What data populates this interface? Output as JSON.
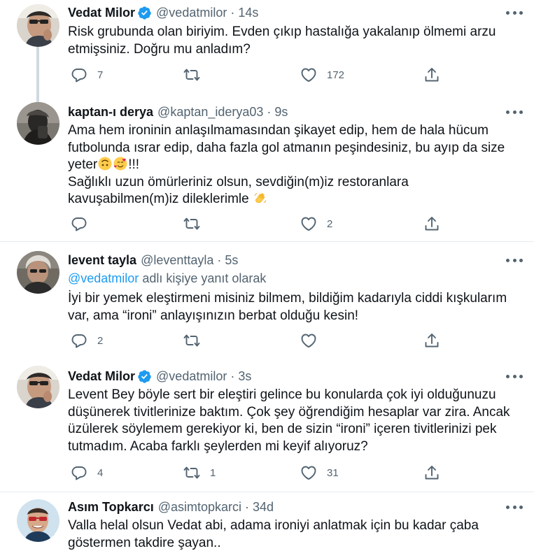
{
  "tweets": [
    {
      "name": "Vedat Milor",
      "verified": true,
      "handle": "@vedatmilor",
      "dot": "·",
      "time": "14s",
      "lines": [
        "Risk grubunda olan biriyim. Evden çıkıp hastalığa yakalanıp ölmemi arzu",
        "etmişsiniz. Doğru mu anladım?"
      ],
      "reply_count": "7",
      "retweet_count": "",
      "like_count": "172"
    },
    {
      "name": "kaptan-ı derya",
      "verified": false,
      "handle": "@kaptan_iderya03",
      "dot": "·",
      "time": "9s",
      "lines": [
        "Ama hem ironinin anlaşılmamasından şikayet edip, hem de hala hücum",
        "futbolunda ısrar edip, daha fazla gol atmanın peşindesiniz, bu ayıp da size",
        "yeter",
        "!!!",
        "Sağlıklı uzun ömürleriniz olsun, sevdiğin(m)iz  restoranlara",
        "kavuşabilmen(m)iz dileklerimle"
      ],
      "emojis": [
        "upside-down-face-emoji",
        "smiling-face-with-hearts-emoji",
        "waving-hand-emoji"
      ],
      "reply_count": "",
      "retweet_count": "",
      "like_count": "2"
    },
    {
      "name": "levent tayla",
      "verified": false,
      "handle": "@leventtayla",
      "dot": "·",
      "time": "5s",
      "reply_to_mention": "@vedatmilor",
      "reply_to_text": " adlı kişiye yanıt olarak",
      "lines": [
        "İyi bir yemek eleştirmeni misiniz bilmem, bildiğim kadarıyla ciddi kışkularım",
        "var, ama “ironi” anlayışınızın berbat olduğu kesin!"
      ],
      "reply_count": "2",
      "retweet_count": "",
      "like_count": ""
    },
    {
      "name": "Vedat Milor",
      "verified": true,
      "handle": "@vedatmilor",
      "dot": "·",
      "time": "3s",
      "lines": [
        "Levent Bey böyle sert bir eleştiri gelince bu konularda çok iyi olduğunuzu",
        "düşünerek tivitlerinize baktım. Çok şey öğrendiğim hesaplar var zira. Ancak",
        "üzülerek söylemem gerekiyor ki, ben de sizin “ironi” içeren tivitlerinizi pek",
        "tutmadım. Acaba farklı şeylerden mi keyif alıyoruz?"
      ],
      "reply_count": "4",
      "retweet_count": "1",
      "like_count": "31"
    },
    {
      "name": "Asım Topkarcı",
      "verified": false,
      "handle": "@asimtopkarci",
      "dot": "·",
      "time": "34d",
      "lines": [
        "Valla helal olsun Vedat abi, adama ironiyi anlatmak için bu kadar çaba",
        "göstermen takdire şayan.."
      ]
    }
  ],
  "icons": {
    "verified": "verified-badge-icon",
    "reply": "reply-icon",
    "retweet": "retweet-icon",
    "like": "like-heart-icon",
    "share": "share-icon",
    "more": "more-options-icon"
  },
  "colors": {
    "text": "#0f1419",
    "secondary": "#536471",
    "accent": "#1d9bf0",
    "thread_line": "#cfd9de",
    "separator": "#e6ecf0"
  }
}
